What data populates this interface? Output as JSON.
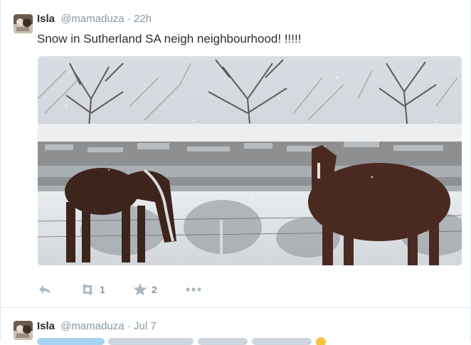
{
  "tweets": [
    {
      "name": "Isla",
      "handle": "@mamaduza",
      "separator": "·",
      "time": "22h",
      "text": "Snow in Sutherland SA neigh neighbourhood! !!!!!",
      "actions": {
        "reply_count": "",
        "retweet_count": "1",
        "favorite_count": "2"
      }
    },
    {
      "name": "Isla",
      "handle": "@mamaduza",
      "separator": "·",
      "time": "Jul 7"
    }
  ],
  "colors": {
    "muted": "#8899a6",
    "text": "#292f33",
    "link": "#55acee",
    "divider": "#e1e8ed"
  }
}
